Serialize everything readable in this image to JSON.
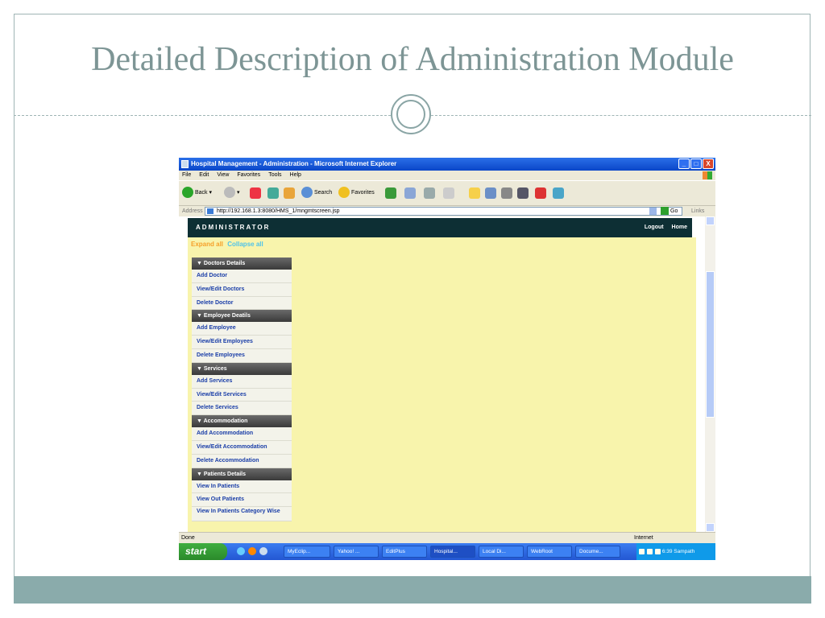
{
  "slide": {
    "title": "Detailed Description of Administration Module"
  },
  "window": {
    "title": "Hospital Management - Administration - Microsoft Internet Explorer",
    "min": "_",
    "max": "□",
    "close": "X"
  },
  "menubar": [
    "File",
    "Edit",
    "View",
    "Favorites",
    "Tools",
    "Help"
  ],
  "toolbar": {
    "back": "Back",
    "search": "Search",
    "favorites": "Favorites"
  },
  "address": {
    "label": "Address",
    "url": "http://192.168.1.3:8080/HMS_1/mngmtscreen.jsp",
    "go": "Go",
    "links": "Links"
  },
  "app": {
    "header_title": "ADMINISTRATOR",
    "logout": "Logout",
    "home": "Home",
    "expand_all": "Expand all",
    "collapse_all": "Collapse all",
    "sections": [
      {
        "title": "▼ Doctors Details",
        "items": [
          "Add Doctor",
          "View/Edit Doctors",
          "Delete Doctor"
        ]
      },
      {
        "title": "▼ Employee Deatils",
        "items": [
          "Add Employee",
          "View/Edit Employees",
          "Delete Employees"
        ]
      },
      {
        "title": "▼ Services",
        "items": [
          "Add Services",
          "View/Edit Services",
          "Delete Services"
        ]
      },
      {
        "title": "▼ Accommodation",
        "items": [
          "Add Accommodation",
          "View/Edit Accommodation",
          "Delete Accommodation"
        ]
      },
      {
        "title": "▼ Patients Details",
        "items": [
          "View In Patients",
          "View Out Patients",
          "View In Patients Category Wise"
        ]
      }
    ]
  },
  "status": {
    "left": "Done",
    "right": "Internet"
  },
  "taskbar": {
    "start": "start",
    "tasks": [
      "MyEclip...",
      "Yahoo! ...",
      "EditPlus",
      "Hospital...",
      "Local Di...",
      "WebRoot",
      "Docume..."
    ],
    "time": "6:39",
    "user": "Sampath"
  }
}
